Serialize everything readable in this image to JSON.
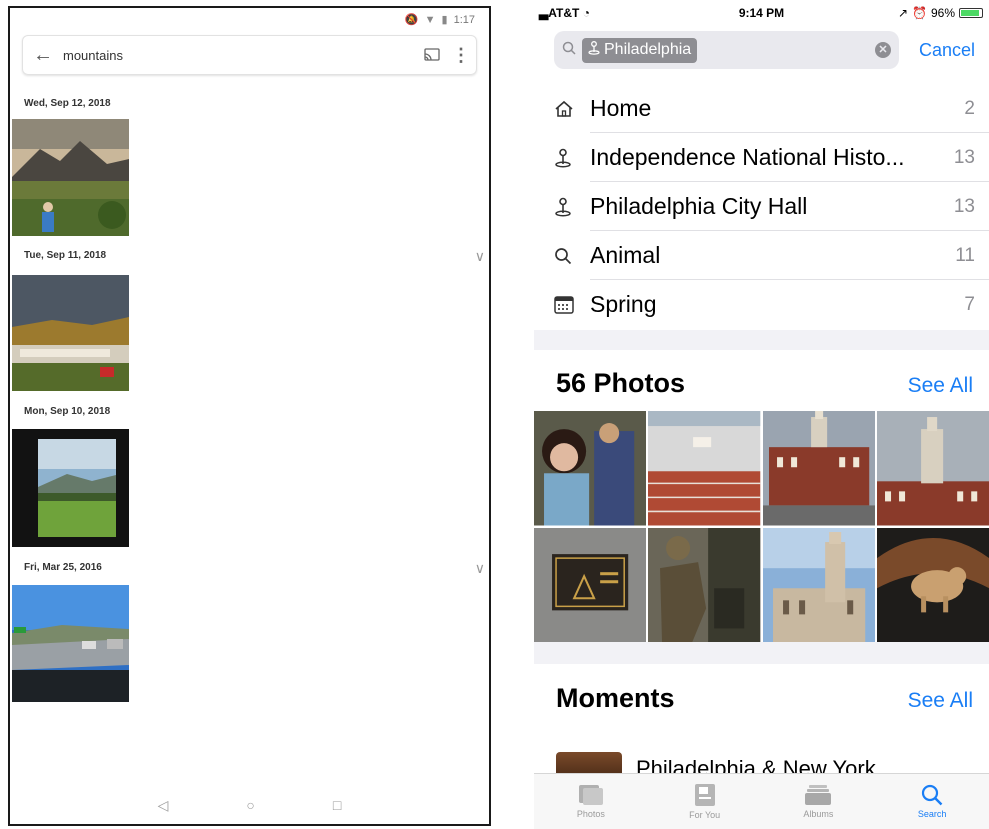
{
  "android": {
    "status_time": "1:17",
    "search_query": "mountains",
    "sections": [
      {
        "date": "Wed, Sep 12, 2018",
        "photo": "mountain-landscape-with-person"
      },
      {
        "date": "Tue, Sep 11, 2018",
        "photo": "hillside-town-cloudy-sky"
      },
      {
        "date": "Mon, Sep 10, 2018",
        "photo": "view-through-window-of-hills"
      },
      {
        "date": "Fri, Mar 25, 2016",
        "photo": "highway-from-car"
      }
    ],
    "nav": [
      "back-icon",
      "home-icon",
      "recents-icon"
    ]
  },
  "ios": {
    "status": {
      "carrier": "AT&T",
      "time": "9:14 PM",
      "battery": "96%"
    },
    "search_token": "Philadelphia",
    "cancel_label": "Cancel",
    "results": [
      {
        "icon": "home-icon",
        "label": "Home",
        "count": "2"
      },
      {
        "icon": "landmark-pin-icon",
        "label": "Independence National Histo...",
        "count": "13"
      },
      {
        "icon": "landmark-pin-icon",
        "label": "Philadelphia City Hall",
        "count": "13"
      },
      {
        "icon": "search-icon",
        "label": "Animal",
        "count": "11"
      },
      {
        "icon": "calendar-icon",
        "label": "Spring",
        "count": "7"
      }
    ],
    "photos_section": {
      "title": "56 Photos",
      "see_all": "See All"
    },
    "moments_section": {
      "title": "Moments",
      "see_all": "See All",
      "first_moment": "Philadelphia & New York"
    },
    "tabs": [
      {
        "label": "Photos",
        "icon": "photos-tab-icon"
      },
      {
        "label": "For You",
        "icon": "for-you-tab-icon"
      },
      {
        "label": "Albums",
        "icon": "albums-tab-icon"
      },
      {
        "label": "Search",
        "icon": "search-tab-icon"
      }
    ],
    "accent": "#1a7ef5"
  }
}
